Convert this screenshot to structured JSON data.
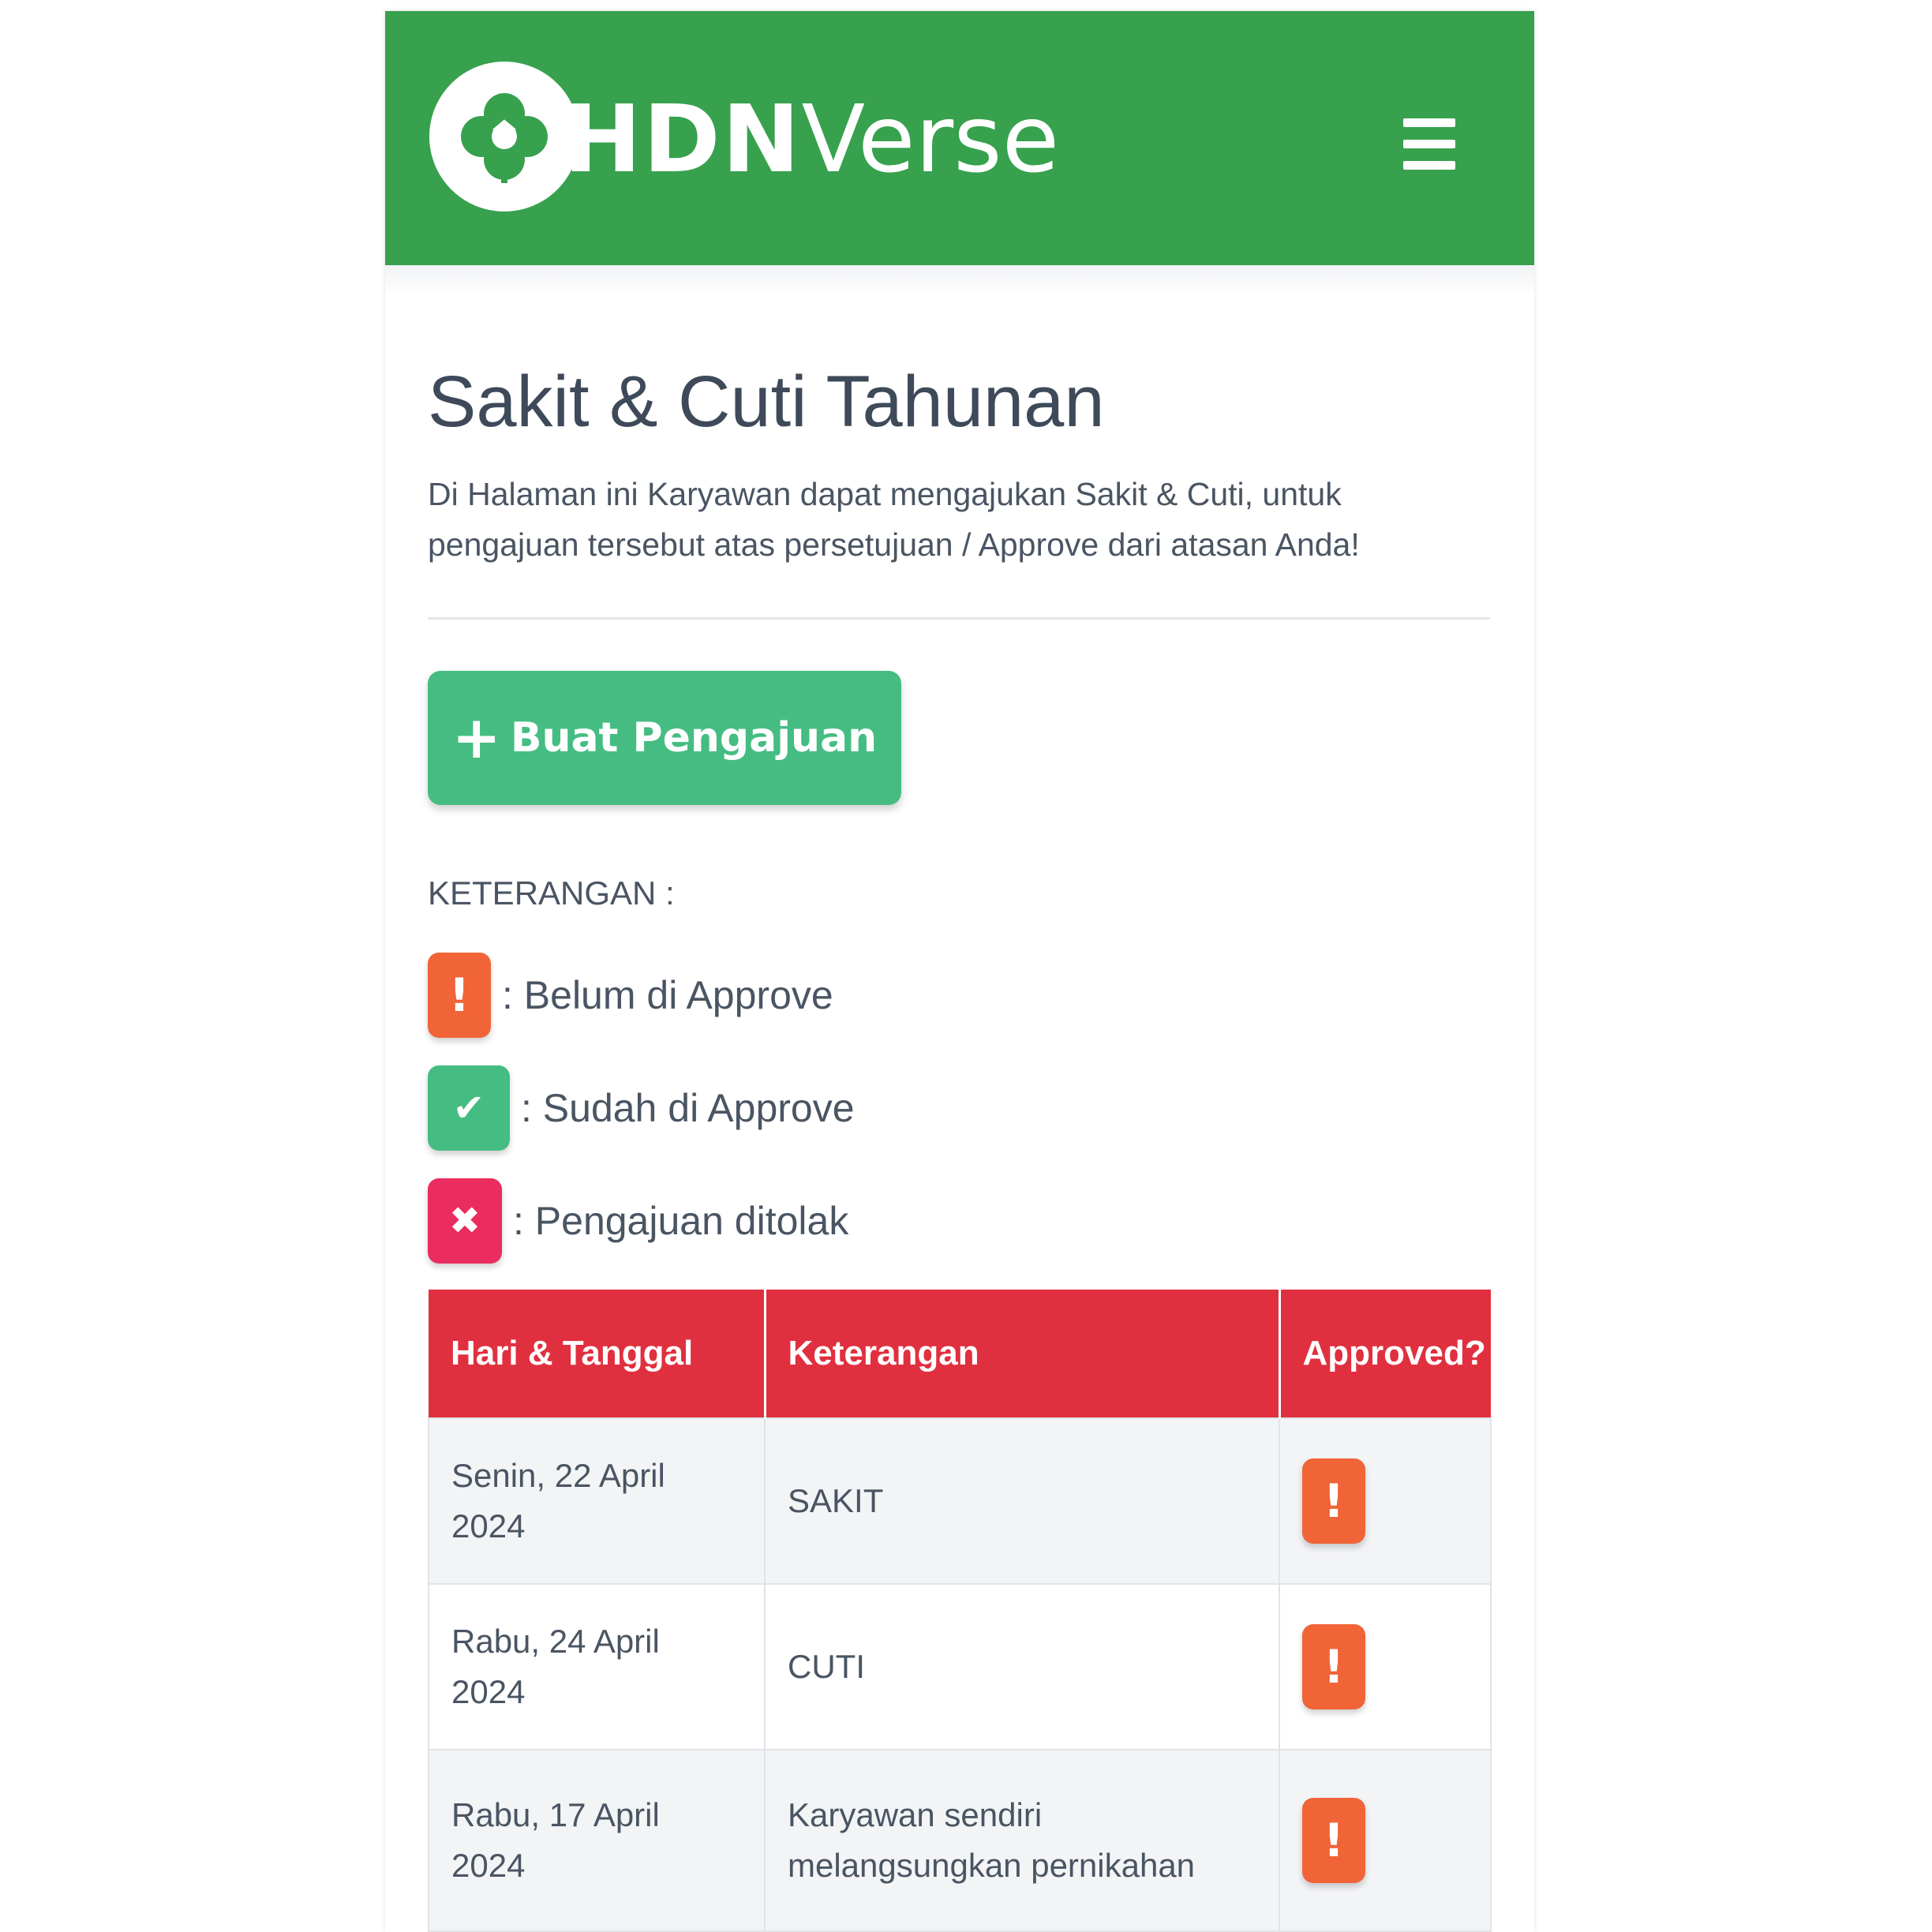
{
  "header": {
    "brand_bold": "HDN",
    "brand_light": "Verse",
    "logo_icon": "clover-icon",
    "menu_icon": "hamburger-menu-icon",
    "background_color": "#37a14e"
  },
  "page": {
    "title": "Sakit & Cuti Tahunan",
    "description": "Di Halaman ini Karyawan dapat mengajukan Sakit & Cuti, untuk pengajuan tersebut atas persetujuan / Approve dari atasan Anda!"
  },
  "actions": {
    "create_label": "Buat Pengajuan",
    "create_icon": "plus-icon",
    "create_color": "#45bd82"
  },
  "legend": {
    "title": "KETERANGAN :",
    "items": [
      {
        "icon": "exclamation-icon",
        "symbol": "!",
        "color": "#f06438",
        "label": ": Belum di Approve"
      },
      {
        "icon": "check-icon",
        "symbol": "✔",
        "color": "#45bd82",
        "label": ": Sudah di Approve"
      },
      {
        "icon": "x-icon",
        "symbol": "✖",
        "color": "#ea2c5e",
        "label": ": Pengajuan ditolak"
      }
    ]
  },
  "table": {
    "header_color": "#e0303f",
    "columns": [
      "Hari & Tanggal",
      "Keterangan",
      "Approved?"
    ],
    "rows": [
      {
        "date": "Senin, 22 April 2024",
        "note": "SAKIT",
        "status": "!",
        "status_icon": "exclamation-icon"
      },
      {
        "date": "Rabu, 24 April 2024",
        "note": "CUTI",
        "status": "!",
        "status_icon": "exclamation-icon"
      },
      {
        "date": "Rabu, 17 April 2024",
        "note": "Karyawan sendiri melangsungkan pernikahan",
        "status": "!",
        "status_icon": "exclamation-icon"
      }
    ]
  }
}
